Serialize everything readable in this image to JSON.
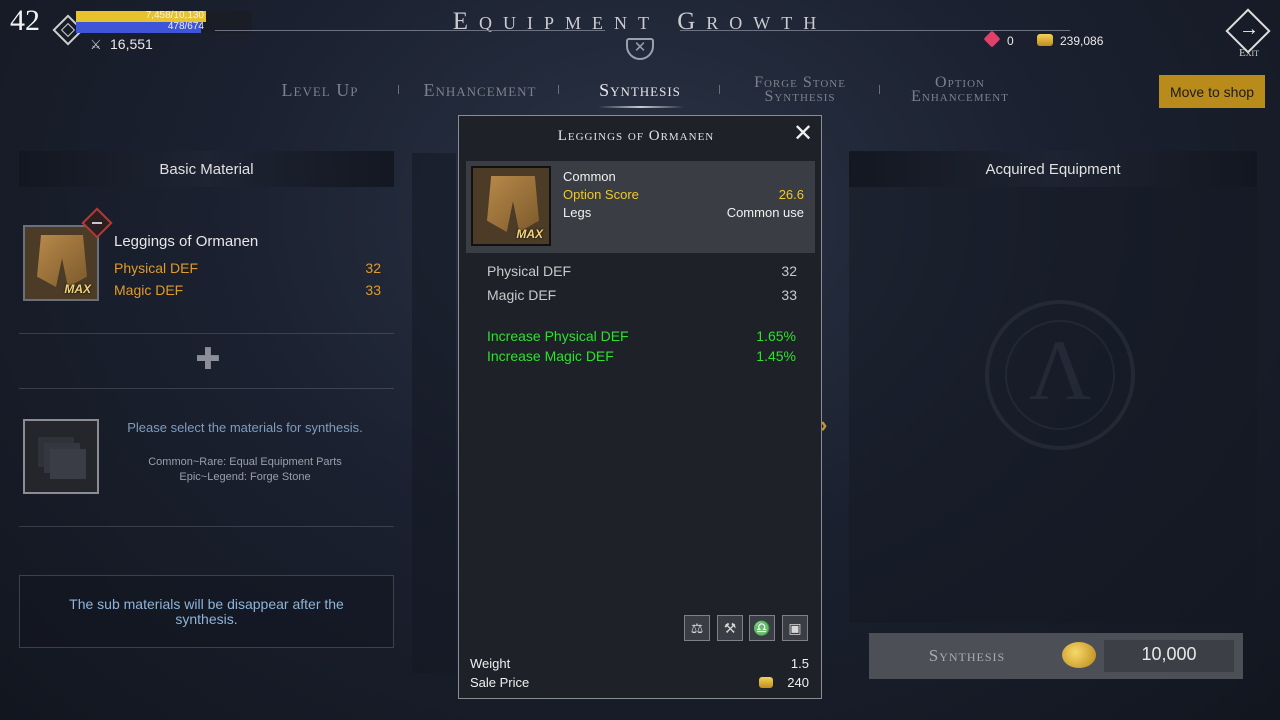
{
  "player": {
    "level": "42",
    "hp_text": "7,458/10,130",
    "mp_text": "478/674",
    "hp_fraction": 0.736,
    "mp_fraction": 0.709,
    "combat_power": "16,551"
  },
  "header": {
    "title": "Equipment Growth",
    "exit_label": "Exit"
  },
  "currency": {
    "gems": "0",
    "gold": "239,086"
  },
  "tabs": [
    {
      "label": "Level Up",
      "active": false
    },
    {
      "label": "Enhancement",
      "active": false
    },
    {
      "label": "Synthesis",
      "active": true
    },
    {
      "line1": "Forge Stone",
      "line2": "Synthesis",
      "active": false
    },
    {
      "line1": "Option",
      "line2": "Enhancement",
      "active": false
    }
  ],
  "shop_button": "Move to shop",
  "left_panel": {
    "header": "Basic Material",
    "item": {
      "name": "Leggings of Ormanen",
      "max_badge": "MAX",
      "stats": [
        {
          "label": "Physical DEF",
          "value": "32"
        },
        {
          "label": "Magic DEF",
          "value": "33"
        }
      ]
    },
    "material_hint": "Please select the materials for synthesis.",
    "material_rule_1": "Common~Rare: Equal Equipment Parts",
    "material_rule_2": "Epic~Legend: Forge Stone",
    "notice": "The sub materials will be disappear after the synthesis."
  },
  "right_panel": {
    "header": "Acquired Equipment"
  },
  "synthesis": {
    "button_label": "Synthesis",
    "cost": "10,000"
  },
  "popup": {
    "title": "Leggings of Ormanen",
    "rarity": "Common",
    "option_score_label": "Option Score",
    "option_score_value": "26.6",
    "slot": "Legs",
    "usage": "Common use",
    "max_badge": "MAX",
    "base_stats": [
      {
        "label": "Physical DEF",
        "value": "32"
      },
      {
        "label": "Magic DEF",
        "value": "33"
      }
    ],
    "bonus_stats": [
      {
        "label": "Increase Physical DEF",
        "value": "1.65%"
      },
      {
        "label": "Increase Magic DEF",
        "value": "1.45%"
      }
    ],
    "tools": [
      "scale-icon",
      "hammer-icon",
      "balance-icon",
      "chest-icon"
    ],
    "weight_label": "Weight",
    "weight_value": "1.5",
    "sale_price_label": "Sale Price",
    "sale_price_value": "240"
  }
}
